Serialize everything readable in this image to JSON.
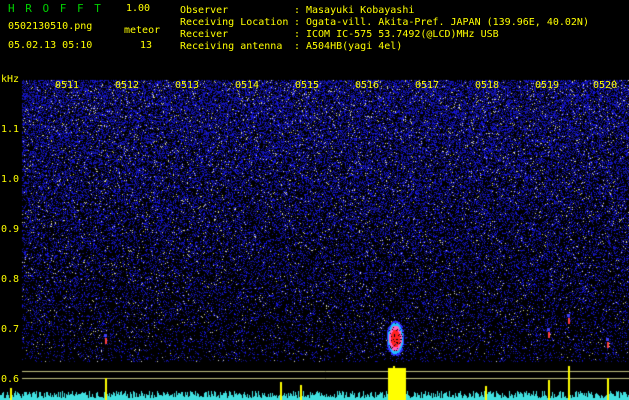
{
  "header": {
    "logo": "H R O F F T",
    "version": "1.00",
    "filename": "0502130510.png",
    "meteor_label": "meteor",
    "datetime": "05.02.13 05:10",
    "meteor_count": "13"
  },
  "info": [
    {
      "label": "Observer",
      "sep": ":",
      "value": "Masayuki Kobayashi"
    },
    {
      "label": "Receiving Location",
      "sep": ":",
      "value": "Ogata-vill. Akita-Pref. JAPAN (139.96E, 40.02N)"
    },
    {
      "label": "Receiver",
      "sep": ":",
      "value": "ICOM IC-575 53.7492(@LCD)MHz USB"
    },
    {
      "label": "Receiving antenna",
      "sep": ":",
      "value": "A504HB(yagi 4el)"
    }
  ],
  "axis": {
    "unit": "kHz",
    "ticks": [
      "1.1",
      "1.0",
      "0.9",
      "0.8",
      "0.7",
      "0.6"
    ]
  },
  "time_labels": [
    "0511",
    "0512",
    "0513",
    "0514",
    "0515",
    "0516",
    "0517",
    "0518",
    "0519",
    "0520"
  ],
  "colors": {
    "background": "#000000",
    "text_yellow": "#ffff00",
    "text_green": "#00d000",
    "noise_blue": "#2020c0",
    "meteor_red": "#ff2020",
    "baseline_cyan": "#40e0e0"
  }
}
